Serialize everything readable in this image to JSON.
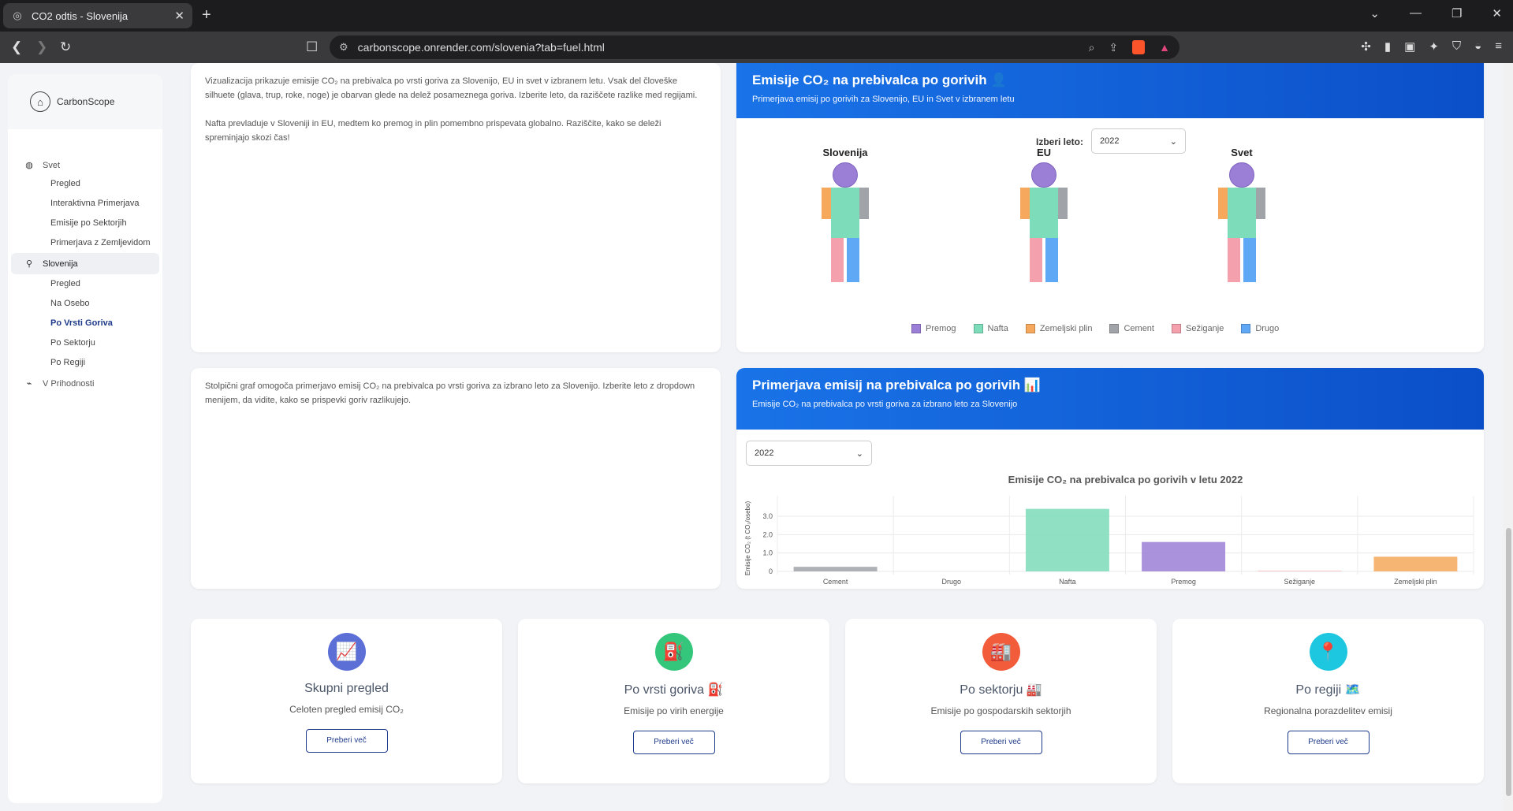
{
  "browser": {
    "tab_title": "CO2 odtis - Slovenija",
    "url": "carbonscope.onrender.com/slovenia?tab=fuel.html"
  },
  "sidebar": {
    "brand": "CarbonScope",
    "sections": [
      {
        "label": "Svet",
        "icon": "globe-icon",
        "items": [
          "Pregled",
          "Interaktivna Primerjava",
          "Emisije po Sektorjih",
          "Primerjava z Zemljevidom"
        ]
      },
      {
        "label": "Slovenija",
        "icon": "map-pin-icon",
        "items": [
          "Pregled",
          "Na Osebo",
          "Po Vrsti Goriva",
          "Po Sektorju",
          "Po Regiji"
        ]
      },
      {
        "label": "V Prihodnosti",
        "icon": "trend-chart-icon",
        "items": []
      }
    ],
    "active_item": "Po Vrsti Goriva"
  },
  "desc1": {
    "p1": "Vizualizacija prikazuje emisije CO₂ na prebivalca po vrsti goriva za Slovenijo, EU in svet v izbranem letu. Vsak del človeške silhuete (glava, trup, roke, noge) je obarvan glede na delež posameznega goriva. Izberite leto, da raziščete razlike med regijami.",
    "p2": "Nafta prevladuje v Sloveniji in EU, medtem ko premog in plin pomembno prispevata globalno. Raziščite, kako se deleži spreminjajo skozi čas!"
  },
  "silhouette_card": {
    "title": "Emisije CO₂ na prebivalca po gorivih 👤",
    "subtitle": "Primerjava emisij po gorivih za Slovenijo, EU in Svet v izbranem letu",
    "year_label": "Izberi leto:",
    "year": "2022",
    "figures": [
      "Slovenija",
      "EU",
      "Svet"
    ],
    "legend": [
      {
        "label": "Premog",
        "color": "#9b7fd6"
      },
      {
        "label": "Nafta",
        "color": "#7ddcb9"
      },
      {
        "label": "Zemeljski plin",
        "color": "#f6a85c"
      },
      {
        "label": "Cement",
        "color": "#a0a3a8"
      },
      {
        "label": "Sežiganje",
        "color": "#f5a0ad"
      },
      {
        "label": "Drugo",
        "color": "#5fa8f5"
      }
    ]
  },
  "desc2": {
    "p1": "Stolpični graf omogoča primerjavo emisij CO₂ na prebivalca po vrsti goriva za izbrano leto za Slovenijo. Izberite leto z dropdown menijem, da vidite, kako se prispevki goriv razlikujejo."
  },
  "bar_card": {
    "title": "Primerjava emisij na prebivalca po gorivih 📊",
    "subtitle": "Emisije CO₂ na prebivalca po vrsti goriva za izbrano leto za Slovenijo",
    "year": "2022"
  },
  "chart_data": {
    "type": "bar",
    "title": "Emisije CO₂ na prebivalca po gorivih v letu 2022",
    "ylabel": "Emisije CO₂ (t CO₂/osebo)",
    "xlabel": "",
    "categories": [
      "Cement",
      "Drugo",
      "Nafta",
      "Premog",
      "Sežiganje",
      "Zemeljski plin"
    ],
    "values": [
      0.25,
      0.0,
      3.4,
      1.6,
      0.03,
      0.8
    ],
    "colors": [
      "#a0a3a8",
      "#5fa8f5",
      "#7ddcb9",
      "#9b7fd6",
      "#f5a0ad",
      "#f6a85c"
    ],
    "yticks": [
      "0",
      "1.0",
      "2.0",
      "3.0"
    ],
    "ylim": [
      0,
      3.6
    ],
    "grid": true
  },
  "mini_cards": [
    {
      "title": "Skupni pregled",
      "subtitle": "Celoten pregled emisij CO₂",
      "button": "Preberi več",
      "icon": "chart-line-icon",
      "color": "#5b6fd6"
    },
    {
      "title": "Po vrsti goriva ⛽",
      "subtitle": "Emisije po virih energije",
      "button": "Preberi več",
      "icon": "gas-pump-icon",
      "color": "#34c77b"
    },
    {
      "title": "Po sektorju 🏭",
      "subtitle": "Emisije po gospodarskih sektorjih",
      "button": "Preberi več",
      "icon": "industry-icon",
      "color": "#f25c3a"
    },
    {
      "title": "Po regiji 🗺️",
      "subtitle": "Regionalna porazdelitev emisij",
      "button": "Preberi več",
      "icon": "map-location-icon",
      "color": "#1ec7e0"
    }
  ]
}
